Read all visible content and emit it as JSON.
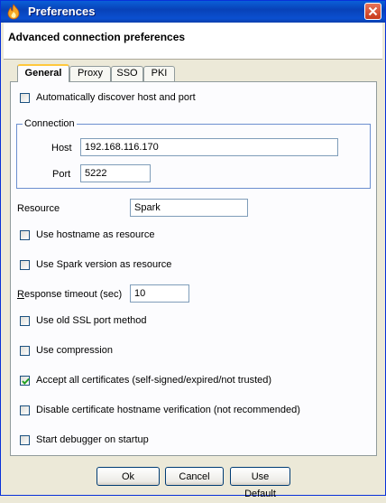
{
  "window": {
    "title": "Preferences",
    "close_icon": "close-icon"
  },
  "header": {
    "text": "Advanced connection preferences"
  },
  "tabs": [
    {
      "label": "General",
      "active": true
    },
    {
      "label": "Proxy",
      "active": false
    },
    {
      "label": "SSO",
      "active": false
    },
    {
      "label": "PKI",
      "active": false
    }
  ],
  "general": {
    "auto_discover": {
      "label": "Automatically discover host and port",
      "checked": false
    },
    "connection": {
      "legend": "Connection",
      "host_label": "Host",
      "host_value": "192.168.116.170",
      "port_label": "Port",
      "port_value": "5222"
    },
    "resource_label": "Resource",
    "resource_value": "Spark",
    "use_hostname": {
      "label": "Use hostname as resource",
      "checked": false
    },
    "use_spark_version": {
      "label": "Use Spark version as resource",
      "checked": false
    },
    "response_timeout": {
      "label_first": "R",
      "label_rest": "esponse timeout (sec)",
      "value": "10"
    },
    "old_ssl": {
      "label": "Use old SSL port method",
      "checked": false
    },
    "compression": {
      "label": "Use compression",
      "checked": false
    },
    "accept_certs": {
      "label": "Accept all certificates (self-signed/expired/not trusted)",
      "checked": true
    },
    "disable_hostname_verification": {
      "label": "Disable certificate hostname verification (not recommended)",
      "checked": false
    },
    "start_debugger": {
      "label": "Start debugger on startup",
      "checked": false
    }
  },
  "buttons": {
    "ok": "Ok",
    "cancel": "Cancel",
    "use_default": "Use Default"
  },
  "colors": {
    "titlebar": "#0a4fd0",
    "tab_highlight": "#ffc83c",
    "dialog_bg": "#ece9d8"
  }
}
